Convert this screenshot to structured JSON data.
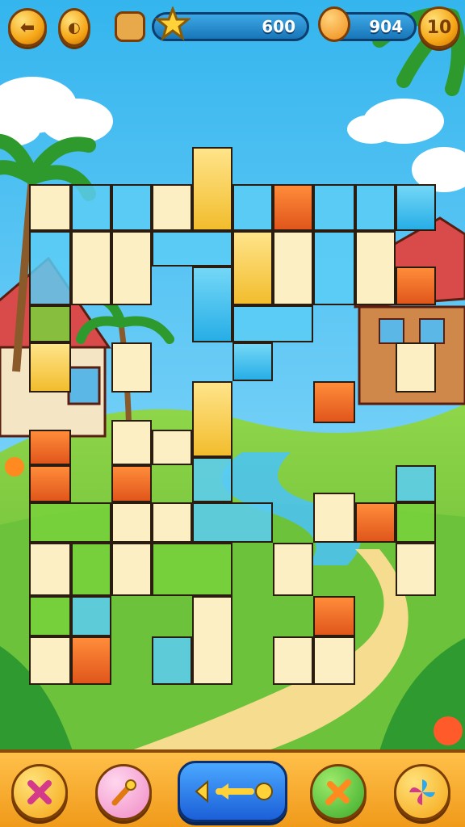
{
  "hud": {
    "star_score": "600",
    "coin_count": "904",
    "level": "10"
  },
  "colors": {
    "sky": "#4fc3f0",
    "grass": "#7ccc3a",
    "tile_yellow": "#f2bd2d",
    "tile_blue": "#27aee6",
    "tile_orange": "#e0561b",
    "tile_cream": "#fcefc4",
    "bar_orange": "#f5a515"
  },
  "toolbar": {
    "buttons": [
      {
        "name": "cancel-button",
        "icon": "x-icon"
      },
      {
        "name": "wand-button",
        "icon": "magic-wand-icon"
      },
      {
        "name": "undo-hint-button",
        "icon": "arrow-left-icon"
      },
      {
        "name": "shuffle-button",
        "icon": "swap-icon"
      },
      {
        "name": "pinwheel-button",
        "icon": "pinwheel-icon"
      }
    ]
  }
}
